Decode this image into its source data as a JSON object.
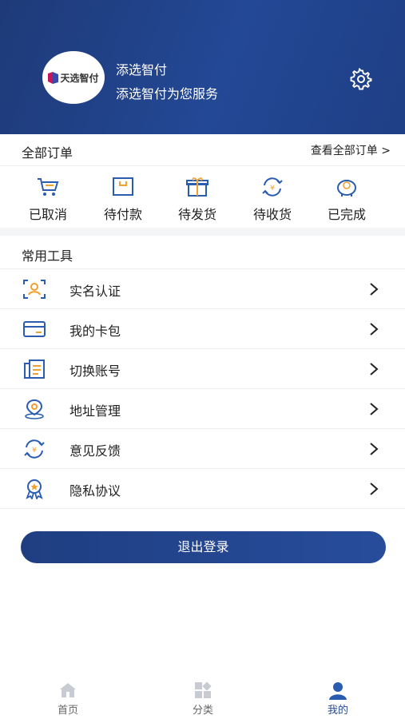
{
  "profile": {
    "logo_text": "天选智付",
    "name": "添选智付",
    "subtitle": "添选智付为您服务"
  },
  "orders": {
    "title": "全部订单",
    "view_all": "查看全部订单 >",
    "items": [
      {
        "label": "已取消",
        "icon": "cart-icon"
      },
      {
        "label": "待付款",
        "icon": "wallet-box-icon"
      },
      {
        "label": "待发货",
        "icon": "gift-icon"
      },
      {
        "label": "待收货",
        "icon": "yen-cycle-icon"
      },
      {
        "label": "已完成",
        "icon": "piggy-bank-icon"
      }
    ]
  },
  "tools": {
    "title": "常用工具",
    "items": [
      {
        "label": "实名认证",
        "icon": "id-verify-icon"
      },
      {
        "label": "我的卡包",
        "icon": "card-icon"
      },
      {
        "label": "切换账号",
        "icon": "switch-account-icon"
      },
      {
        "label": "地址管理",
        "icon": "location-pin-icon"
      },
      {
        "label": "意见反馈",
        "icon": "feedback-icon"
      },
      {
        "label": "隐私协议",
        "icon": "privacy-badge-icon"
      }
    ]
  },
  "logout_label": "退出登录",
  "tabbar": {
    "items": [
      {
        "label": "首页",
        "icon": "home-icon"
      },
      {
        "label": "分类",
        "icon": "category-icon"
      },
      {
        "label": "我的",
        "icon": "user-icon",
        "active": true
      }
    ]
  },
  "colors": {
    "header": "#234895",
    "accent_blue": "#2a5cb0",
    "accent_orange": "#f0a030",
    "tab_active": "#2a4d94"
  }
}
